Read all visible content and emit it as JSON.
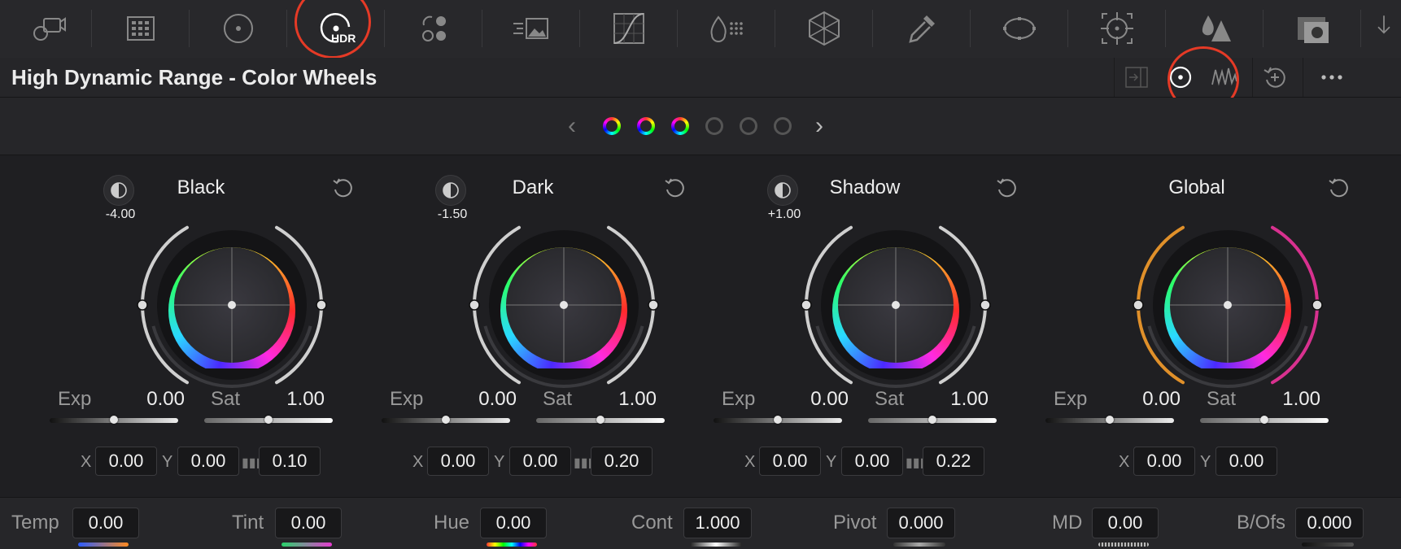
{
  "toolbar": {
    "tools": [
      {
        "name": "camera-raw-icon"
      },
      {
        "name": "color-match-icon"
      },
      {
        "name": "primaries-wheels-icon"
      },
      {
        "name": "hdr-wheels-icon",
        "badge": "HDR",
        "selected": true
      },
      {
        "name": "rgb-mixer-icon"
      },
      {
        "name": "motion-effects-icon"
      },
      {
        "name": "curves-icon"
      },
      {
        "name": "color-warper-icon"
      },
      {
        "name": "warper-mesh-icon"
      },
      {
        "name": "qualifier-eyedropper-icon"
      },
      {
        "name": "window-icon"
      },
      {
        "name": "tracker-icon"
      },
      {
        "name": "blur-icon"
      },
      {
        "name": "key-icon"
      }
    ]
  },
  "title": "High Dynamic Range - Color Wheels",
  "view_buttons": [
    {
      "name": "split-view-icon"
    },
    {
      "name": "wheels-view-icon",
      "selected": true
    },
    {
      "name": "waveform-view-icon"
    },
    {
      "name": "reset-all-icon"
    },
    {
      "name": "more-options-icon"
    }
  ],
  "pager": {
    "prev": "‹",
    "next": "›",
    "pages": [
      "color",
      "color",
      "color",
      "empty",
      "empty",
      "empty"
    ]
  },
  "panels": [
    {
      "name": "Black",
      "lum": "-4.00",
      "exp_label": "Exp",
      "exp": "0.00",
      "sat_label": "Sat",
      "sat": "1.00",
      "x_label": "X",
      "x": "0.00",
      "y_label": "Y",
      "y": "0.00",
      "falloff": "0.10",
      "ring_left_color": "#cfcfcf",
      "ring_right_color": "#cfcfcf"
    },
    {
      "name": "Dark",
      "lum": "-1.50",
      "exp_label": "Exp",
      "exp": "0.00",
      "sat_label": "Sat",
      "sat": "1.00",
      "x_label": "X",
      "x": "0.00",
      "y_label": "Y",
      "y": "0.00",
      "falloff": "0.20",
      "ring_left_color": "#cfcfcf",
      "ring_right_color": "#cfcfcf"
    },
    {
      "name": "Shadow",
      "lum": "+1.00",
      "exp_label": "Exp",
      "exp": "0.00",
      "sat_label": "Sat",
      "sat": "1.00",
      "x_label": "X",
      "x": "0.00",
      "y_label": "Y",
      "y": "0.00",
      "falloff": "0.22",
      "ring_left_color": "#cfcfcf",
      "ring_right_color": "#cfcfcf"
    },
    {
      "name": "Global",
      "lum": "",
      "exp_label": "Exp",
      "exp": "0.00",
      "sat_label": "Sat",
      "sat": "1.00",
      "x_label": "X",
      "x": "0.00",
      "y_label": "Y",
      "y": "0.00",
      "falloff": "",
      "ring_left_color": "#e0902a",
      "ring_right_color": "#d8318f"
    }
  ],
  "bottom": {
    "temp_label": "Temp",
    "temp": "0.00",
    "tint_label": "Tint",
    "tint": "0.00",
    "hue_label": "Hue",
    "hue": "0.00",
    "cont_label": "Cont",
    "cont": "1.000",
    "pivot_label": "Pivot",
    "pivot": "0.000",
    "md_label": "MD",
    "md": "0.00",
    "bofs_label": "B/Ofs",
    "bofs": "0.000"
  },
  "colors": {
    "accent_ring": "#e53a26",
    "panel_bg": "#1f1f22",
    "bar_bg": "#262629"
  }
}
